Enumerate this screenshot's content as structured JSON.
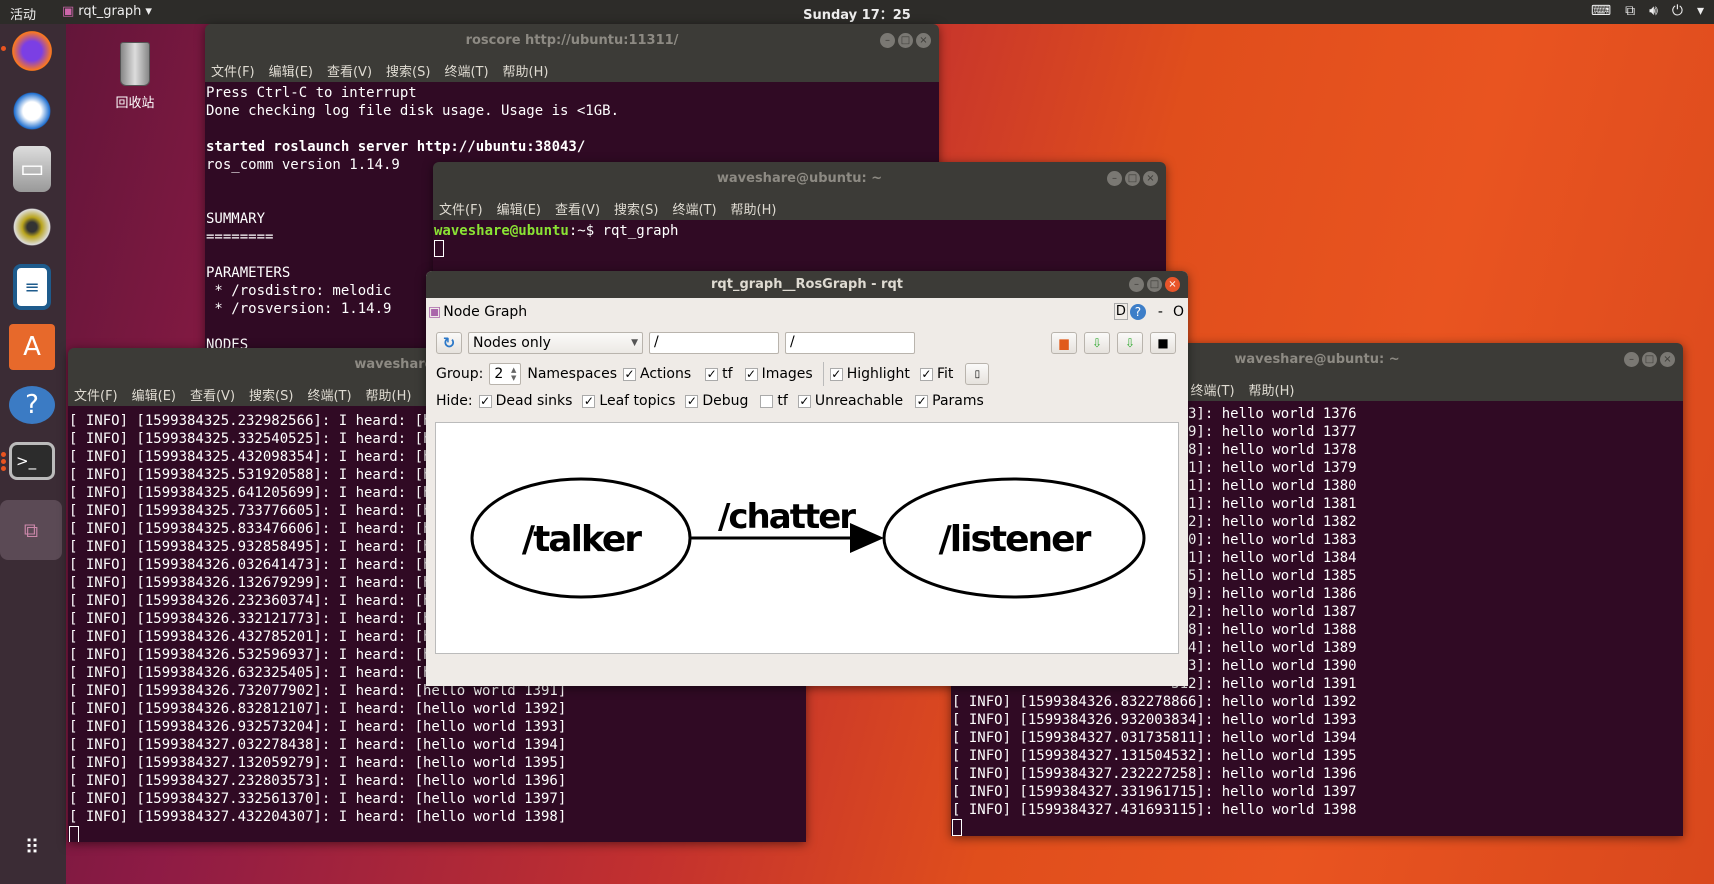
{
  "topbar": {
    "activities": "活动",
    "app_name": "rqt_graph",
    "app_menu_arrow": "▾",
    "clock": "Sunday 17：25",
    "tray_icons": [
      "keyboard-icon",
      "network-icon",
      "volume-icon",
      "power-icon",
      "menu-arrow-icon"
    ]
  },
  "dock": {
    "items": [
      "firefox",
      "thunderbird",
      "files",
      "rhythmbox",
      "libreoffice-writer",
      "ubuntu-software",
      "help",
      "terminal",
      "rqt-graph"
    ],
    "show_apps": "show-applications-icon"
  },
  "desktop": {
    "trash_label": "回收站"
  },
  "terminal_menu": [
    "文件(F)",
    "编辑(E)",
    "查看(V)",
    "搜索(S)",
    "终端(T)",
    "帮助(H)"
  ],
  "roscore": {
    "title": "roscore http://ubuntu:11311/",
    "lines": [
      "Press Ctrl-C to interrupt",
      "Done checking log file disk usage. Usage is <1GB.",
      "",
      "started roslaunch server http://ubuntu:38043/",
      "ros_comm version 1.14.9",
      "",
      "",
      "SUMMARY",
      "========",
      "",
      "PARAMETERS",
      " * /rosdistro: melodic",
      " * /rosversion: 1.14.9",
      "",
      "NODES"
    ]
  },
  "shell": {
    "title": "waveshare@ubuntu: ~",
    "prompt": "waveshare@ubuntu",
    "path": ":~$ ",
    "command": "rqt_graph"
  },
  "listener_term": {
    "title": "waveshare@ubuntu: ~",
    "lines": [
      "[ INFO] [1599384325.232982566]: I heard: [hello world 1376]",
      "[ INFO] [1599384325.332540525]: I heard: [hello world 1377]",
      "[ INFO] [1599384325.432098354]: I heard: [hello world 1378]",
      "[ INFO] [1599384325.531920588]: I heard: [hello world 1379]",
      "[ INFO] [1599384325.641205699]: I heard: [hello world 1380]",
      "[ INFO] [1599384325.733776605]: I heard: [hello world 1381]",
      "[ INFO] [1599384325.833476606]: I heard: [hello world 1382]",
      "[ INFO] [1599384325.932858495]: I heard: [hello world 1383]",
      "[ INFO] [1599384326.032641473]: I heard: [hello world 1384]",
      "[ INFO] [1599384326.132679299]: I heard: [hello world 1385]",
      "[ INFO] [1599384326.232360374]: I heard: [hello world 1386]",
      "[ INFO] [1599384326.332121773]: I heard: [hello world 1387]",
      "[ INFO] [1599384326.432785201]: I heard: [hello world 1388]",
      "[ INFO] [1599384326.532596937]: I heard: [hello world 1389]",
      "[ INFO] [1599384326.632325405]: I heard: [hello world 1390]",
      "[ INFO] [1599384326.732077902]: I heard: [hello world 1391]",
      "[ INFO] [1599384326.832812107]: I heard: [hello world 1392]",
      "[ INFO] [1599384326.932573204]: I heard: [hello world 1393]",
      "[ INFO] [1599384327.032278438]: I heard: [hello world 1394]",
      "[ INFO] [1599384327.132059279]: I heard: [hello world 1395]",
      "[ INFO] [1599384327.232803573]: I heard: [hello world 1396]",
      "[ INFO] [1599384327.332561370]: I heard: [hello world 1397]",
      "[ INFO] [1599384327.432204307]: I heard: [hello world 1398]"
    ]
  },
  "talker_term": {
    "title": "waveshare@ubuntu: ~",
    "partial_lines": [
      "213]: hello world 1376",
      "579]: hello world 1377",
      "228]: hello world 1378",
      "721]: hello world 1379",
      "701]: hello world 1380",
      "091]: hello world 1381",
      "512]: hello world 1382",
      "560]: hello world 1383",
      "541]: hello world 1384",
      "525]: hello world 1385",
      "519]: hello world 1386",
      "302]: hello world 1387",
      "568]: hello world 1388",
      "344]: hello world 1389",
      "393]: hello world 1390",
      "312]: hello world 1391"
    ],
    "lines": [
      "[ INFO] [1599384326.832278866]: hello world 1392",
      "[ INFO] [1599384326.932003834]: hello world 1393",
      "[ INFO] [1599384327.031735811]: hello world 1394",
      "[ INFO] [1599384327.131504532]: hello world 1395",
      "[ INFO] [1599384327.232227258]: hello world 1396",
      "[ INFO] [1599384327.331961715]: hello world 1397",
      "[ INFO] [1599384327.431693115]: hello world 1398"
    ]
  },
  "rqt": {
    "title": "rqt_graph__RosGraph - rqt",
    "plugin_title": "Node Graph",
    "d_label": "D",
    "help": "?",
    "minimize": "-",
    "close": "O",
    "mode": "Nodes only",
    "ns_filter": "/",
    "topic_filter": "/",
    "group_label": "Group:",
    "group_value": "2",
    "group_opts": [
      {
        "label": "Namespaces",
        "checked": null
      },
      {
        "label": "Actions",
        "checked": true
      },
      {
        "label": "tf",
        "checked": true
      },
      {
        "label": "Images",
        "checked": true
      },
      {
        "label": "Highlight",
        "checked": true
      },
      {
        "label": "Fit",
        "checked": true
      }
    ],
    "hide_label": "Hide:",
    "hide_opts": [
      {
        "label": "Dead sinks",
        "checked": true
      },
      {
        "label": "Leaf topics",
        "checked": true
      },
      {
        "label": "Debug",
        "checked": true
      },
      {
        "label": "tf",
        "checked": false
      },
      {
        "label": "Unreachable",
        "checked": true
      },
      {
        "label": "Params",
        "checked": true
      }
    ],
    "graph": {
      "nodes": [
        "/talker",
        "/listener"
      ],
      "edge_label": "/chatter"
    }
  }
}
